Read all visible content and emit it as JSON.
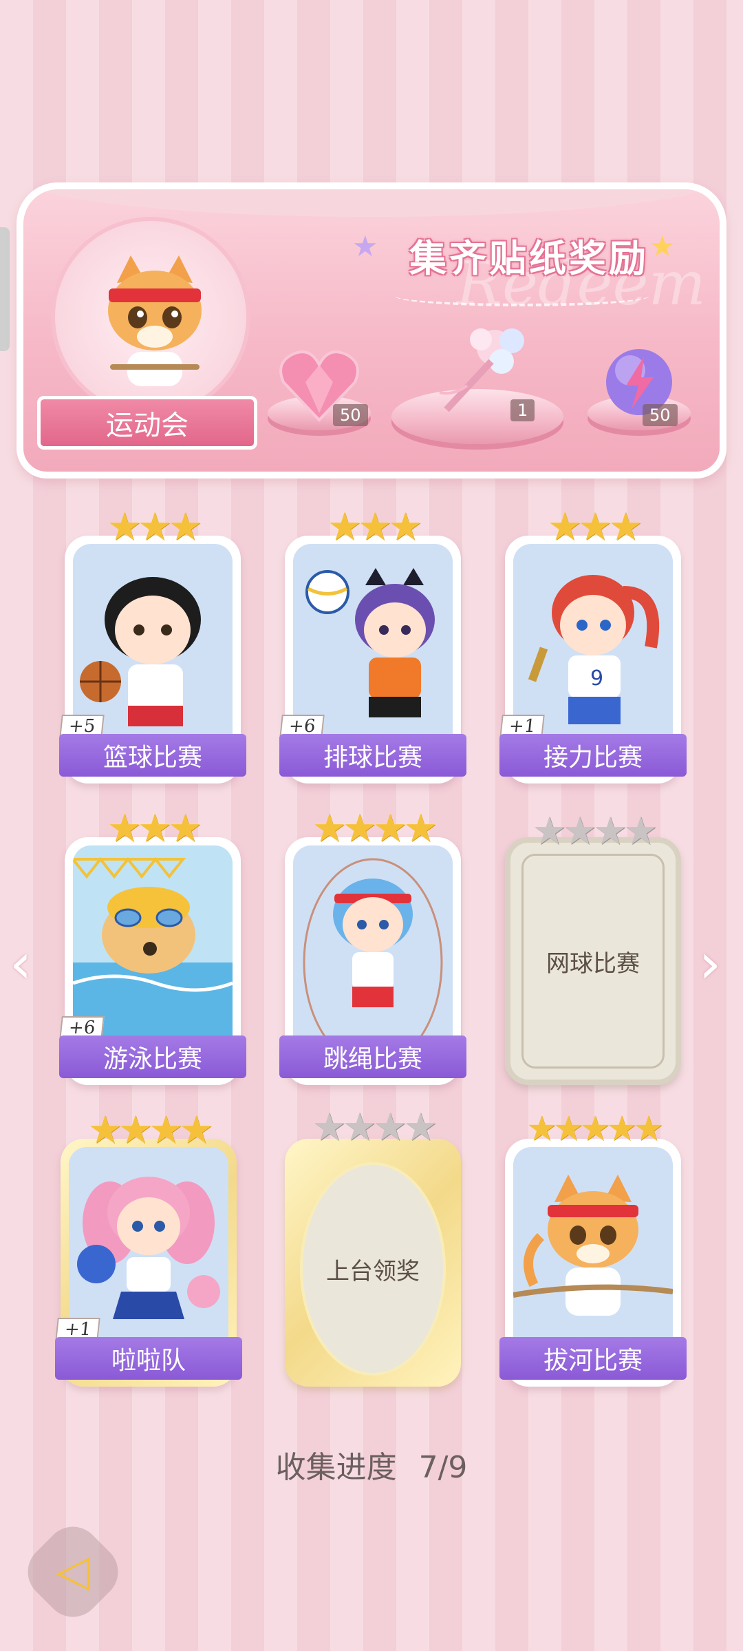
{
  "banner": {
    "title": "集齐贴纸奖励",
    "watermark": "Redeem",
    "badge_label": "运动会",
    "rewards": [
      {
        "icon": "pink-heart-gem-icon",
        "count": "50"
      },
      {
        "icon": "flower-bouquet-icon",
        "count": "1"
      },
      {
        "icon": "purple-energy-orb-icon",
        "count": "50"
      }
    ]
  },
  "cards": [
    {
      "label": "篮球比赛",
      "stars": 3,
      "max_stars": 3,
      "bonus": "+5",
      "collected": true,
      "art": "basketball-girl"
    },
    {
      "label": "排球比赛",
      "stars": 3,
      "max_stars": 3,
      "bonus": "+6",
      "collected": true,
      "art": "volleyball-girl"
    },
    {
      "label": "接力比赛",
      "stars": 3,
      "max_stars": 3,
      "bonus": "+1",
      "collected": true,
      "art": "relay-runner"
    },
    {
      "label": "游泳比赛",
      "stars": 3,
      "max_stars": 3,
      "bonus": "+6",
      "collected": true,
      "art": "swimming-dog"
    },
    {
      "label": "跳绳比赛",
      "stars": 4,
      "max_stars": 4,
      "bonus": "",
      "collected": true,
      "art": "jump-rope-girl"
    },
    {
      "label": "网球比赛",
      "stars": 0,
      "max_stars": 4,
      "bonus": "",
      "collected": false,
      "art": "locked"
    },
    {
      "label": "啦啦队",
      "stars": 4,
      "max_stars": 4,
      "bonus": "+1",
      "collected": true,
      "art": "cheerleader"
    },
    {
      "label": "上台领奖",
      "stars": 0,
      "max_stars": 4,
      "bonus": "",
      "collected": false,
      "art": "locked-gold"
    },
    {
      "label": "拔河比赛",
      "stars": 5,
      "max_stars": 5,
      "bonus": "",
      "collected": true,
      "art": "tug-of-war-cat"
    }
  ],
  "progress": {
    "label": "收集进度",
    "value": "7/9"
  },
  "colors": {
    "accent_purple": "#8a5ad6",
    "pink": "#f2aabb",
    "gold_star": "#f6c13a"
  }
}
